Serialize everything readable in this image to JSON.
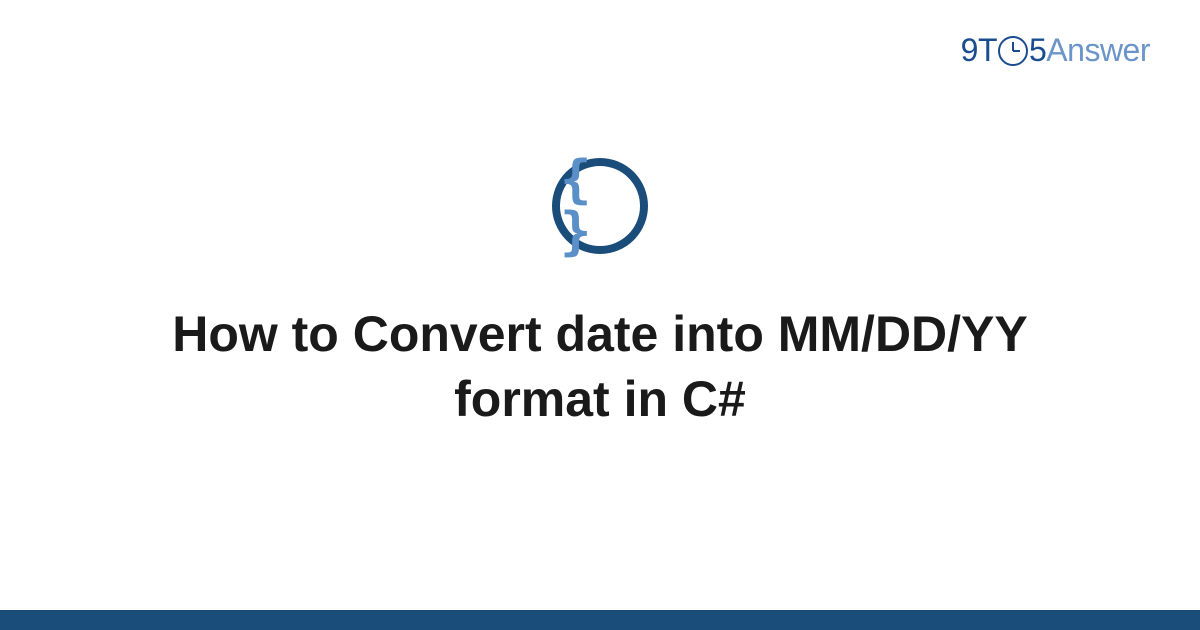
{
  "logo": {
    "part1": "9T",
    "part2": "5",
    "part3": "Answer"
  },
  "icon": {
    "name": "code-braces-icon",
    "glyph": "{ }"
  },
  "title": "How to Convert date into MM/DD/YY format in C#",
  "colors": {
    "brand_dark": "#1a4d7a",
    "brand_blue": "#1a4d8f",
    "brand_light": "#6b94c9",
    "brace_blue": "#5a8fc7"
  }
}
